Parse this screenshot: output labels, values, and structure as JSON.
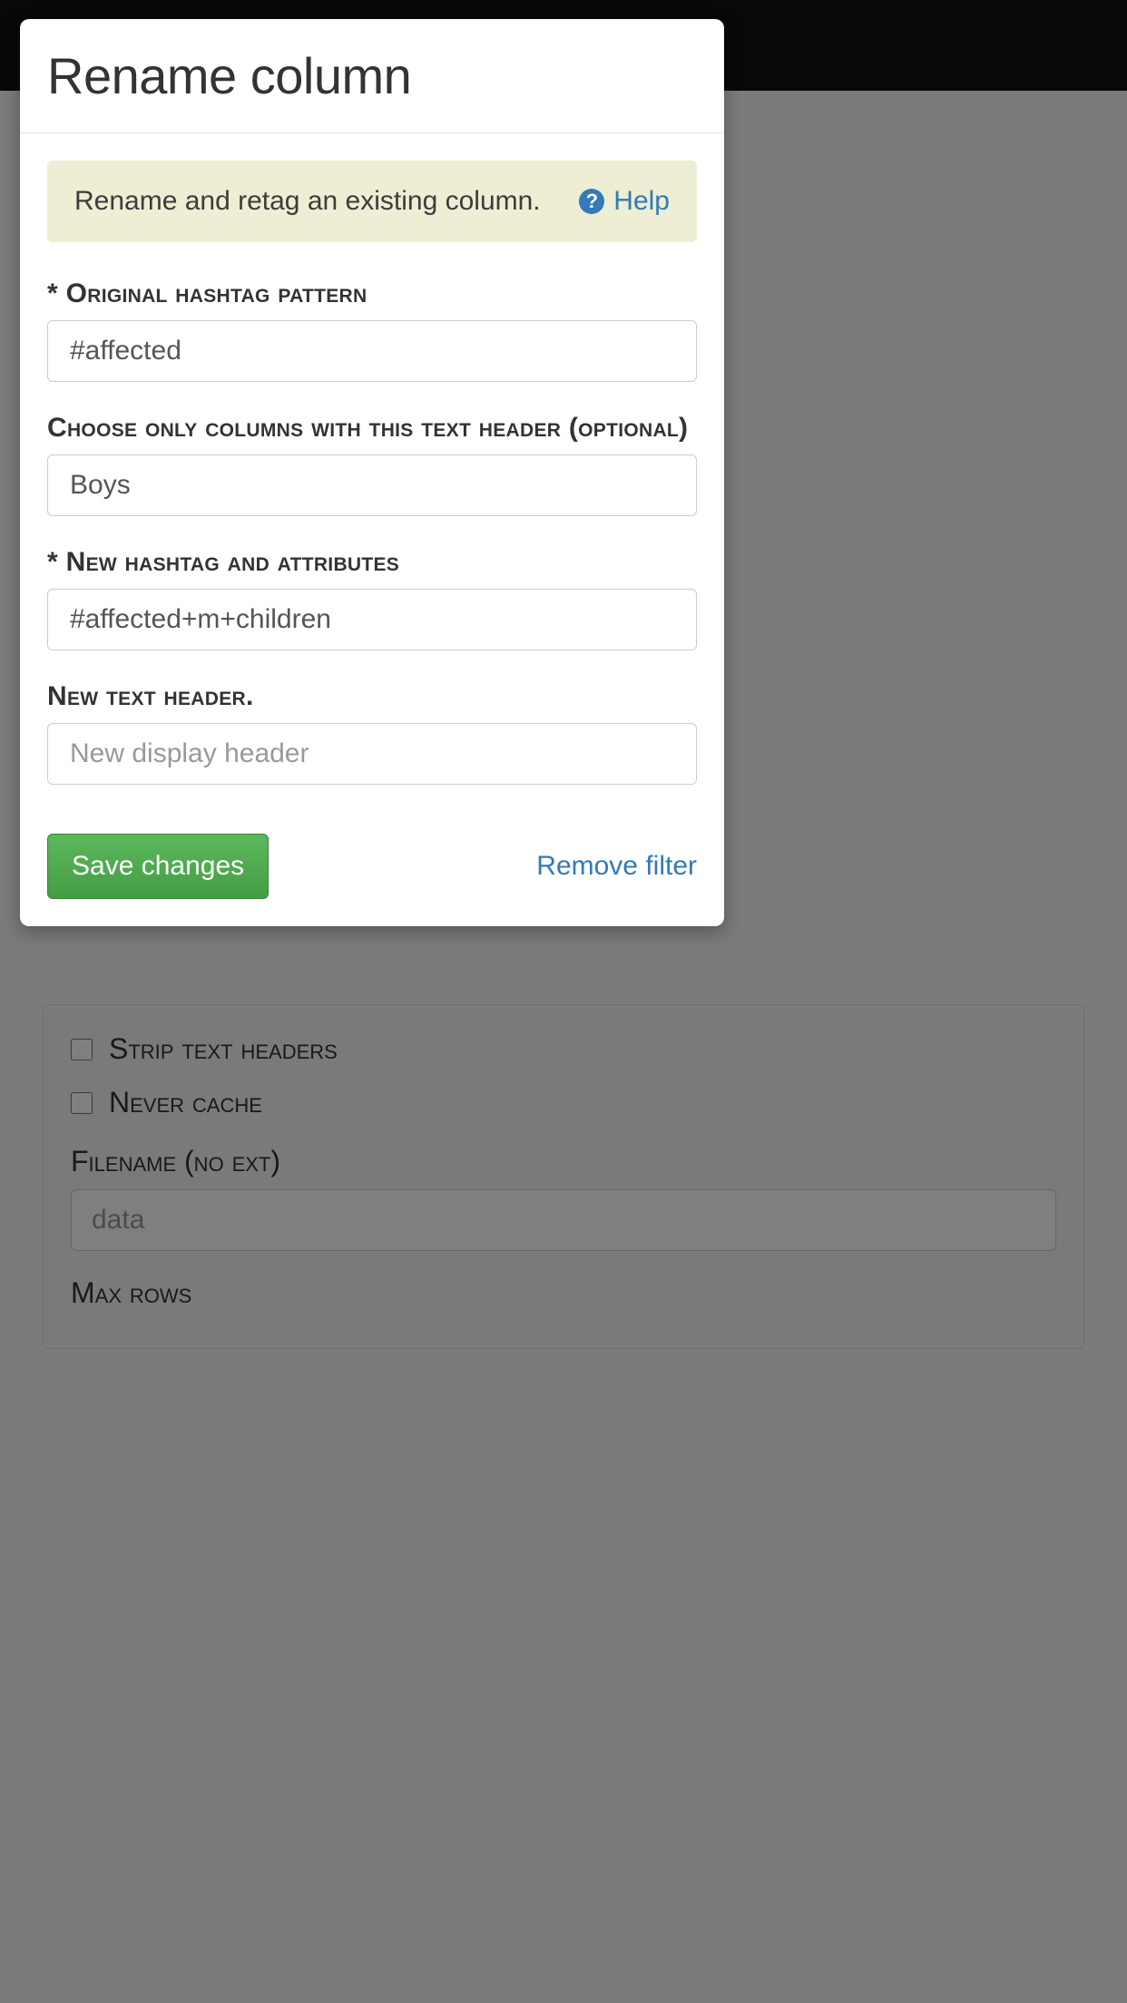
{
  "modal": {
    "title": "Rename column",
    "alert_text": "Rename and retag an existing column.",
    "help_label": "Help",
    "fields": {
      "orig_pattern": {
        "label": "* Original hashtag pattern",
        "value": "#affected"
      },
      "text_header": {
        "label": "Choose only columns with this text header (optional)",
        "value": "Boys"
      },
      "new_hashtag": {
        "label": "* New hashtag and attributes",
        "value": "#affected+m+children"
      },
      "new_header": {
        "label": "New text header.",
        "placeholder": "New display header"
      }
    },
    "save_label": "Save changes",
    "remove_label": "Remove filter"
  },
  "background": {
    "strip_headers_label": "Strip text headers",
    "never_cache_label": "Never cache",
    "filename_label": "Filename (no ext)",
    "filename_placeholder": "data",
    "max_rows_label": "Max rows"
  }
}
